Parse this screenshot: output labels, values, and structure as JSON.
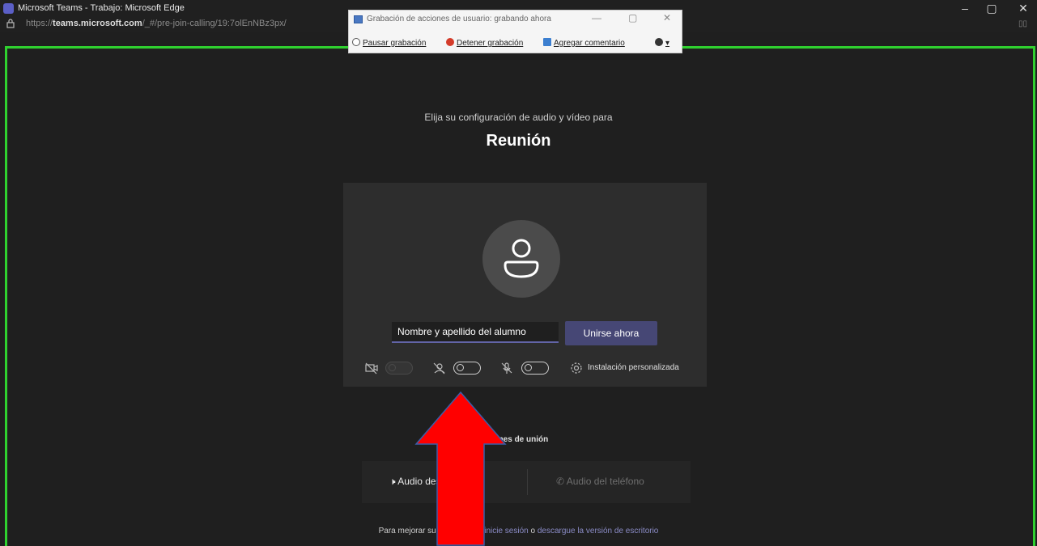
{
  "browser": {
    "window_title": "Microsoft Teams - Trabajo: Microsoft Edge",
    "url_prefix": "https://",
    "url_domain": "teams.microsoft.com",
    "url_path": "/_#/pre-join-calling/19:7olEnNBz3px/",
    "controls": {
      "minimize": "–",
      "maximize": "▢",
      "close": "✕"
    }
  },
  "recorder": {
    "title": "Grabación de acciones de usuario: grabando ahora",
    "pause_label": "Pausar grabación",
    "stop_label": "Detener grabación",
    "comment_label": "Agregar comentario",
    "help_label": "▾"
  },
  "prejoin": {
    "subtitle": "Elija su configuración de audio y vídeo para",
    "meeting_title": "Reunión",
    "name_input_value": "Nombre y apellido del alumno",
    "join_label": "Unirse ahora",
    "custom_setup_label": "Instalación personalizada",
    "other_options_label": "Otras opciones de unión",
    "audio_off_label": "Audio desactivado",
    "phone_audio_label": "Audio del teléfono",
    "footer_prefix": "Para mejorar su experiencia,",
    "footer_link1": "inicie sesión",
    "footer_mid": "o",
    "footer_link2": "descargue la versión de escritorio",
    "toggles": {
      "video_on": false,
      "blur_on": false,
      "mic_on": false
    }
  },
  "colors": {
    "accent": "#6264a7",
    "join_button": "#464775",
    "recording_border": "#2fd12f",
    "arrow": "#ff0000"
  }
}
